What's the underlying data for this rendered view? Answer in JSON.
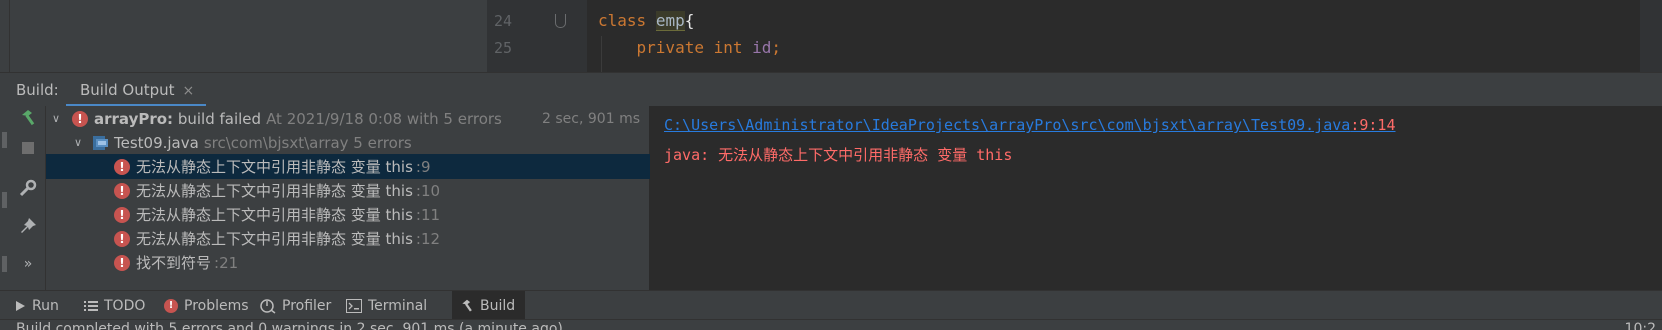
{
  "editor": {
    "lines": [
      {
        "number": "24",
        "keyword": "class",
        "name": "emp",
        "brace": "{"
      },
      {
        "number": "25",
        "modifier": "private",
        "type": "int",
        "field": "id",
        "end": ";"
      }
    ]
  },
  "tool_window": {
    "title": "Build:",
    "tab_label": "Build Output",
    "tab_close": "×"
  },
  "tree": {
    "root": {
      "name": "arrayPro:",
      "status": "build failed",
      "detail": "At 2021/9/18 0:08 with 5 errors",
      "duration": "2 sec, 901 ms"
    },
    "file": {
      "name": "Test09.java",
      "detail": "src\\com\\bjsxt\\array 5 errors"
    },
    "errors": [
      {
        "message": "无法从静态上下文中引用非静态 变量 this",
        "line": ":9"
      },
      {
        "message": "无法从静态上下文中引用非静态 变量 this",
        "line": ":10"
      },
      {
        "message": "无法从静态上下文中引用非静态 变量 this",
        "line": ":11"
      },
      {
        "message": "无法从静态上下文中引用非静态 变量 this",
        "line": ":12"
      },
      {
        "message": "找不到符号",
        "line": ":21"
      }
    ]
  },
  "detail": {
    "path": "C:\\Users\\Administrator\\IdeaProjects\\arrayPro\\src\\com\\bjsxt\\array\\Test09.java",
    "location": ":9:14",
    "message": "java: 无法从静态上下文中引用非静态 变量 this"
  },
  "bottom_tabs": [
    {
      "label": "Run",
      "icon": "play-icon"
    },
    {
      "label": "TODO",
      "icon": "list-icon"
    },
    {
      "label": "Problems",
      "icon": "error-icon"
    },
    {
      "label": "Profiler",
      "icon": "profiler-icon"
    },
    {
      "label": "Terminal",
      "icon": "terminal-icon"
    },
    {
      "label": "Build",
      "icon": "hammer-icon",
      "active": true
    }
  ],
  "status_bar": {
    "text": "Build completed with 5 errors and 0 warnings in 2 sec, 901 ms (a minute ago)",
    "position": "10:2"
  },
  "colors": {
    "error": "#c75450",
    "link": "#287bde",
    "error_text": "#ff6b68",
    "selection": "#0d293e",
    "accent": "#4a88c7"
  }
}
